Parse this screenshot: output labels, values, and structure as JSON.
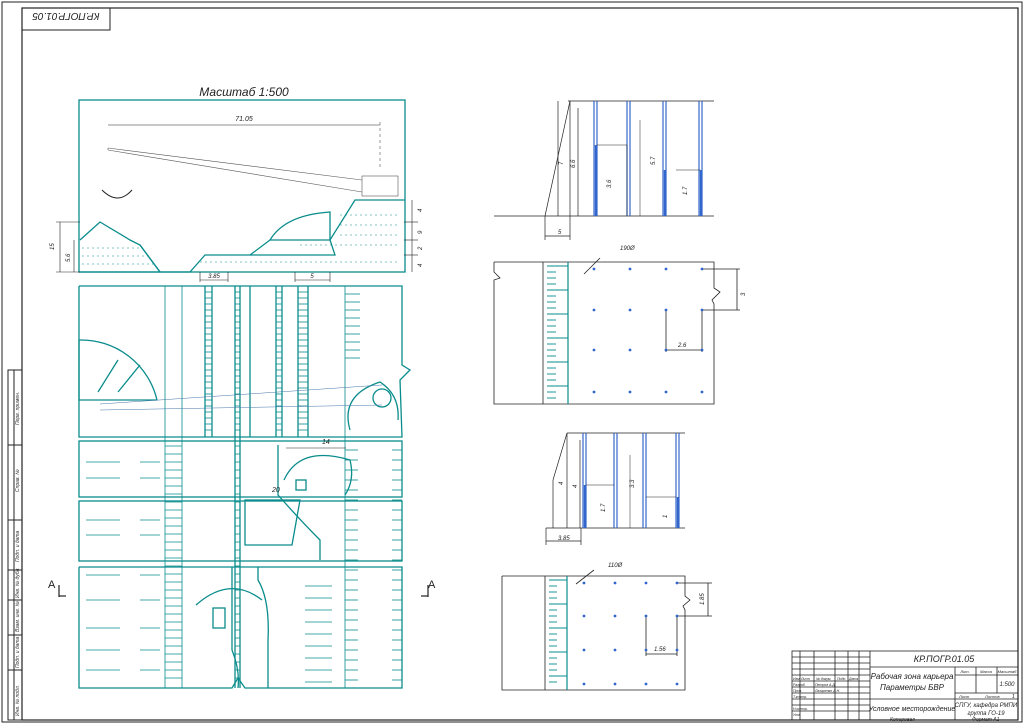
{
  "drawing": {
    "stamp_code": "КР.ПОГР.01.05",
    "scale_title": "Масштаб 1:500",
    "dims": {
      "length": "71.05",
      "h15": "15",
      "h56": "5.6",
      "h4": "4",
      "h9": "9",
      "h2": "2",
      "b385": "3.85",
      "b5": "5",
      "w20": "20",
      "w14": "14",
      "up_7": "7",
      "up_66": "6.6",
      "up_36": "3.6",
      "up_57": "5.7",
      "up_17": "1.7",
      "up_5": "5",
      "up_dia": "190Ø",
      "up_3": "3",
      "up_26": "2.6",
      "lo_4a": "4",
      "lo_4b": "4",
      "lo_17": "1.7",
      "lo_33": "3.3",
      "lo_1": "1",
      "lo_385": "3.85",
      "lo_dia": "110Ø",
      "lo_185": "1.85",
      "lo_156": "1.56"
    },
    "section_mark": "А",
    "side_cells": [
      "Перв. примен.",
      "Справ. №",
      "Подп. и дата",
      "Инв. № дубл.",
      "Взам. инв. №",
      "Подп. и дата",
      "Инв. № подл."
    ],
    "title_block": {
      "code": "КР.ПОГР.01.05",
      "title_line1": "Рабочая зона карьера",
      "title_line2": "Параметры БВР",
      "subtitle": "Условное месторождение",
      "col_headers": [
        "Лит.",
        "Масса",
        "Масштаб"
      ],
      "scale": "1:500",
      "sheet_label": "Лист",
      "sheets_label": "Листов",
      "sheets_count": "1",
      "org1": "СПГУ, кафедра РМПИ",
      "org2": "группа ГО-19",
      "roles": [
        "Изм.",
        "Лист",
        "№ докум.",
        "Подп.",
        "Дата"
      ],
      "row_labels": [
        "Разраб.",
        "Пров.",
        "Т.контр.",
        "",
        "Н.контр.",
        "Утв."
      ],
      "names": [
        "Петров А.Д.",
        "Лазаренко Д.Н."
      ],
      "copied": "Копировал",
      "format": "Формат A1"
    }
  }
}
